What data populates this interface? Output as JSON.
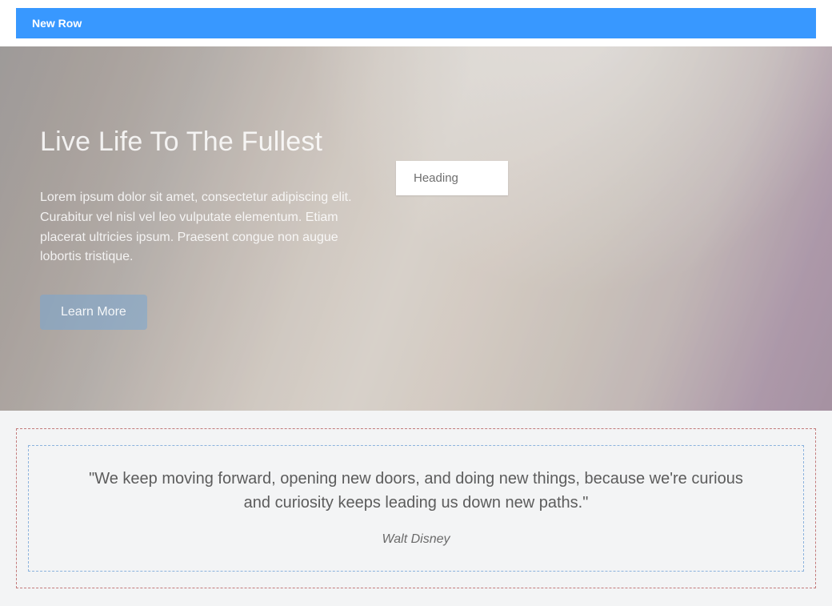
{
  "toolbar": {
    "label": "New Row"
  },
  "hero": {
    "title": "Live Life To The Fullest",
    "text": "Lorem ipsum dolor sit amet, consectetur adipiscing elit. Curabitur vel nisl vel leo vulputate elementum. Etiam placerat ultricies ipsum. Praesent congue non augue lobortis tristique.",
    "button": "Learn More",
    "heading_card": "Heading"
  },
  "quote": {
    "text": "\"We keep moving forward, opening new doors, and doing new things, because we're curious and curiosity keeps leading us down new paths.\"",
    "author": "Walt Disney"
  }
}
